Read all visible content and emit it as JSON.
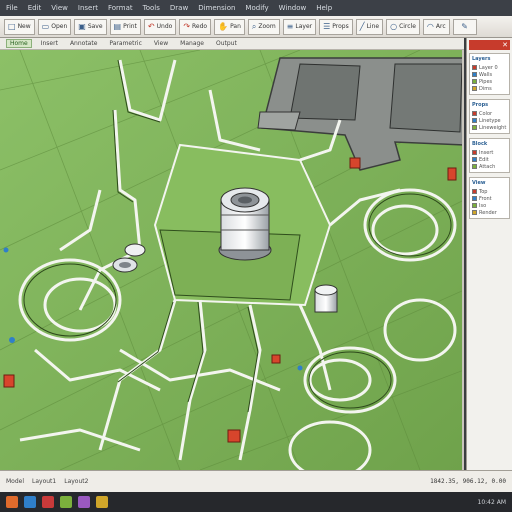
{
  "window": {
    "title_items": [
      "File",
      "Edit",
      "View",
      "Insert",
      "Format",
      "Tools",
      "Draw",
      "Dimension",
      "Modify",
      "Window",
      "Help"
    ]
  },
  "toolbar": {
    "buttons": [
      {
        "label": "New",
        "icon": "new-file-icon"
      },
      {
        "label": "Open",
        "icon": "folder-icon"
      },
      {
        "label": "Save",
        "icon": "save-icon"
      },
      {
        "label": "Print",
        "icon": "print-icon"
      },
      {
        "label": "Undo",
        "icon": "undo-icon"
      },
      {
        "label": "Redo",
        "icon": "redo-icon"
      },
      {
        "label": "Pan",
        "icon": "hand-icon"
      },
      {
        "label": "Zoom",
        "icon": "zoom-icon"
      },
      {
        "label": "Layer",
        "icon": "layers-icon"
      },
      {
        "label": "Props",
        "icon": "properties-icon"
      },
      {
        "label": "Line",
        "icon": "line-icon"
      },
      {
        "label": "Circle",
        "icon": "circle-icon"
      },
      {
        "label": "Arc",
        "icon": "arc-icon"
      }
    ],
    "tool_button": {
      "icon": "tool-icon"
    }
  },
  "tabs": [
    "Home",
    "Insert",
    "Annotate",
    "Parametric",
    "View",
    "Manage",
    "Output"
  ],
  "active_tab": "Home",
  "viewport": {
    "background": "#7fb25a",
    "line_color": "#f2f4ee",
    "accent_red": "#d7452c"
  },
  "right_panel": {
    "sections": [
      {
        "title": "Layers",
        "rows": [
          "Layer 0",
          "Walls",
          "Pipes",
          "Dims"
        ]
      },
      {
        "title": "Props",
        "rows": [
          "Color",
          "Linetype",
          "Lineweight"
        ]
      },
      {
        "title": "Block",
        "rows": [
          "Insert",
          "Edit",
          "Attach"
        ]
      },
      {
        "title": "View",
        "rows": [
          "Top",
          "Front",
          "Iso",
          "Render"
        ]
      }
    ]
  },
  "status": {
    "tabs": [
      "Model",
      "Layout1",
      "Layout2"
    ],
    "coord": "1842.35, 906.12, 0.00"
  },
  "taskbar": {
    "icons": [
      "#e06b2c",
      "#2f7fc9",
      "#c93a3a",
      "#7bb03c",
      "#9a59c0",
      "#d0a62a"
    ],
    "clock": "10:42 AM"
  }
}
